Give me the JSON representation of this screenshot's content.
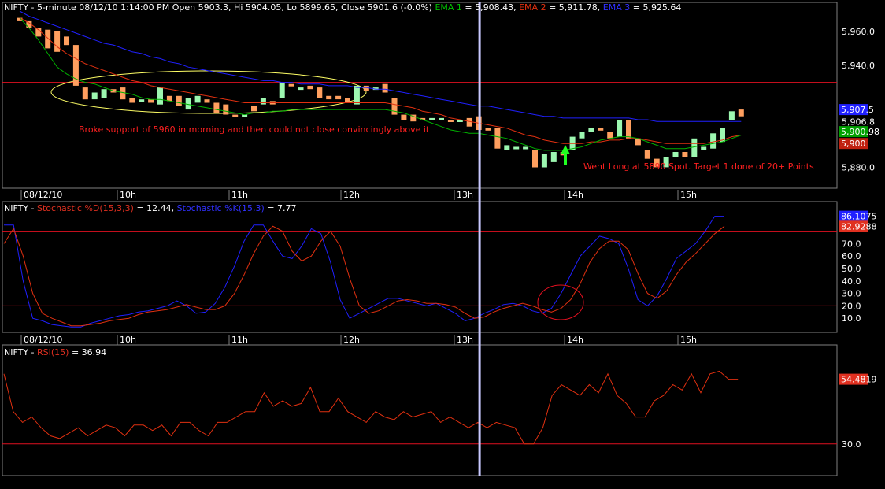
{
  "colors": {
    "background": "#000000",
    "grid": "#7f7f7f",
    "text": "#ffffff",
    "ema1": "#00b000",
    "ema2": "#e03010",
    "ema3": "#2020ff",
    "bull": "#9cf7b0",
    "bear": "#ff9f5f",
    "hline": "#e01020",
    "cursor": "#c8c8ff",
    "ellipse": "#ffff66",
    "circle": "#e01020",
    "arrow": "#20ff20",
    "annotation": "#ff2020"
  },
  "header": {
    "symbol": "NIFTY",
    "info": " - 5-minute 08/12/10 1:14:00 PM Open 5903.3, Hi 5904.05, Lo 5899.65, Close 5901.6 (-0.0%) ",
    "ema1_label": "EMA 1",
    "ema1_value": " = 5,908.43, ",
    "ema2_label": "EMA 2",
    "ema2_value": " = 5,911.78, ",
    "ema3_label": "EMA 3",
    "ema3_value": " = 5,925.64"
  },
  "stoch_header": {
    "symbol": "NIFTY",
    "sep": " - ",
    "d_label": "Stochastic %D(15,3,3)",
    "d_value": " = 12.44, ",
    "k_label": "Stochastic %K(15,3)",
    "k_value": " = 7.77"
  },
  "rsi_header": {
    "symbol": "NIFTY",
    "sep": " - ",
    "label": "RSI(15)",
    "value": " = 36.94"
  },
  "time_axis": [
    "08/12/10",
    "10h",
    "11h",
    "12h",
    "13h",
    "14h",
    "15h"
  ],
  "annotations": {
    "breakdown": "Broke support of 5960 in morning and then could not close convincingly above it",
    "long": "Went Long at 5890 Spot. Target 1 done of 20+ Points"
  },
  "chart_data": [
    {
      "type": "candlestick",
      "series_names": [
        "EMA 1",
        "EMA 2",
        "EMA 3"
      ],
      "ylim": [
        5870,
        5972
      ],
      "yticks": [
        5880,
        5906.8,
        5940,
        5960
      ],
      "ytick_labels": [
        "5,880.0",
        "5,906.8",
        "5,940.0",
        "5,960.0"
      ],
      "value_tags": [
        {
          "label": "5,907.5",
          "value": 5914,
          "color": "#2020ff"
        },
        {
          "label": "5,900.98",
          "value": 5901,
          "color": "#00a000"
        },
        {
          "label": "5,900",
          "value": 5894,
          "color": "#c02010"
        }
      ],
      "hline": 5930,
      "cursor_index": 49,
      "candles": [
        {
          "o": 5968,
          "c": 5966
        },
        {
          "o": 5966,
          "c": 5962
        },
        {
          "o": 5962,
          "c": 5957
        },
        {
          "o": 5961,
          "c": 5950
        },
        {
          "o": 5960,
          "c": 5948
        },
        {
          "o": 5957,
          "c": 5952
        },
        {
          "o": 5952,
          "c": 5928
        },
        {
          "o": 5927,
          "c": 5920
        },
        {
          "o": 5920,
          "c": 5924
        },
        {
          "o": 5921,
          "c": 5926
        },
        {
          "o": 5926,
          "c": 5924
        },
        {
          "o": 5927,
          "c": 5920
        },
        {
          "o": 5921,
          "c": 5918
        },
        {
          "o": 5919,
          "c": 5920
        },
        {
          "o": 5920,
          "c": 5918
        },
        {
          "o": 5917,
          "c": 5927
        },
        {
          "o": 5922,
          "c": 5919
        },
        {
          "o": 5922,
          "c": 5916
        },
        {
          "o": 5914,
          "c": 5921
        },
        {
          "o": 5918,
          "c": 5922
        },
        {
          "o": 5920,
          "c": 5918
        },
        {
          "o": 5918,
          "c": 5912
        },
        {
          "o": 5917,
          "c": 5911
        },
        {
          "o": 5911,
          "c": 5910
        },
        {
          "o": 5910,
          "c": 5911
        },
        {
          "o": 5916,
          "c": 5913
        },
        {
          "o": 5917,
          "c": 5921
        },
        {
          "o": 5919,
          "c": 5917
        },
        {
          "o": 5921,
          "c": 5930
        },
        {
          "o": 5929,
          "c": 5928
        },
        {
          "o": 5927,
          "c": 5927
        },
        {
          "o": 5928,
          "c": 5926
        },
        {
          "o": 5927,
          "c": 5921
        },
        {
          "o": 5922,
          "c": 5920
        },
        {
          "o": 5922,
          "c": 5920
        },
        {
          "o": 5921,
          "c": 5918
        },
        {
          "o": 5917,
          "c": 5928
        },
        {
          "o": 5928,
          "c": 5925
        },
        {
          "o": 5927,
          "c": 5927
        },
        {
          "o": 5929,
          "c": 5924
        },
        {
          "o": 5921,
          "c": 5911
        },
        {
          "o": 5911,
          "c": 5908
        },
        {
          "o": 5911,
          "c": 5907
        },
        {
          "o": 5909,
          "c": 5908
        },
        {
          "o": 5908,
          "c": 5909
        },
        {
          "o": 5909,
          "c": 5909
        },
        {
          "o": 5908,
          "c": 5907
        },
        {
          "o": 5908,
          "c": 5908
        },
        {
          "o": 5909,
          "c": 5904
        },
        {
          "o": 5910,
          "c": 5902
        },
        {
          "o": 5903,
          "c": 5902
        },
        {
          "o": 5903,
          "c": 5891
        },
        {
          "o": 5890,
          "c": 5893
        },
        {
          "o": 5892,
          "c": 5892
        },
        {
          "o": 5892,
          "c": 5892
        },
        {
          "o": 5890,
          "c": 5880
        },
        {
          "o": 5880,
          "c": 5888
        },
        {
          "o": 5883,
          "c": 5889
        },
        {
          "o": 5889,
          "c": 5887
        },
        {
          "o": 5890,
          "c": 5898
        },
        {
          "o": 5897,
          "c": 5901
        },
        {
          "o": 5901,
          "c": 5903
        },
        {
          "o": 5903,
          "c": 5902
        },
        {
          "o": 5901,
          "c": 5897
        },
        {
          "o": 5898,
          "c": 5908
        },
        {
          "o": 5908,
          "c": 5897
        },
        {
          "o": 5897,
          "c": 5893
        },
        {
          "o": 5890,
          "c": 5885
        },
        {
          "o": 5885,
          "c": 5880
        },
        {
          "o": 5880,
          "c": 5886
        },
        {
          "o": 5886,
          "c": 5889
        },
        {
          "o": 5889,
          "c": 5886
        },
        {
          "o": 5886,
          "c": 5897
        },
        {
          "o": 5890,
          "c": 5892
        },
        {
          "o": 5891,
          "c": 5900
        },
        {
          "o": 5895,
          "c": 5903
        },
        {
          "o": 5908,
          "c": 5913
        },
        {
          "o": 5914,
          "c": 5910
        }
      ],
      "ema1": [
        5968,
        5962,
        5955,
        5947,
        5939,
        5935,
        5932,
        5930,
        5929,
        5927,
        5925,
        5924,
        5923,
        5921,
        5920,
        5920,
        5919,
        5918,
        5917,
        5916,
        5915,
        5914,
        5913,
        5912,
        5911,
        5912,
        5912,
        5913,
        5913,
        5914,
        5914,
        5914,
        5914,
        5914,
        5914,
        5914,
        5914,
        5914,
        5914,
        5914,
        5913,
        5912,
        5910,
        5908,
        5906,
        5904,
        5902,
        5901,
        5900,
        5900,
        5899,
        5898,
        5897,
        5895,
        5893,
        5891,
        5890,
        5890,
        5890,
        5891,
        5892,
        5894,
        5896,
        5897,
        5898,
        5898,
        5897,
        5895,
        5893,
        5891,
        5891,
        5891,
        5892,
        5893,
        5894,
        5895,
        5897,
        5899
      ],
      "ema2": [
        5968,
        5965,
        5961,
        5956,
        5951,
        5947,
        5944,
        5941,
        5939,
        5937,
        5935,
        5933,
        5931,
        5930,
        5928,
        5927,
        5926,
        5925,
        5924,
        5923,
        5922,
        5921,
        5920,
        5919,
        5918,
        5918,
        5918,
        5918,
        5918,
        5918,
        5918,
        5918,
        5918,
        5918,
        5918,
        5918,
        5918,
        5918,
        5918,
        5918,
        5917,
        5916,
        5915,
        5913,
        5912,
        5911,
        5909,
        5908,
        5907,
        5906,
        5905,
        5904,
        5903,
        5901,
        5899,
        5898,
        5896,
        5895,
        5894,
        5894,
        5894,
        5895,
        5895,
        5896,
        5896,
        5897,
        5897,
        5896,
        5895,
        5894,
        5894,
        5894,
        5894,
        5894,
        5895,
        5896,
        5898,
        5899
      ],
      "ema3": [
        5972,
        5969,
        5967,
        5965,
        5963,
        5961,
        5959,
        5957,
        5955,
        5953,
        5952,
        5950,
        5948,
        5947,
        5945,
        5944,
        5942,
        5941,
        5939,
        5938,
        5937,
        5936,
        5935,
        5934,
        5933,
        5932,
        5931,
        5931,
        5930,
        5930,
        5929,
        5929,
        5929,
        5928,
        5928,
        5928,
        5927,
        5927,
        5926,
        5926,
        5925,
        5924,
        5923,
        5922,
        5921,
        5920,
        5919,
        5918,
        5917,
        5916,
        5916,
        5915,
        5914,
        5913,
        5912,
        5911,
        5910,
        5910,
        5909,
        5909,
        5909,
        5909,
        5909,
        5909,
        5909,
        5909,
        5908,
        5908,
        5907,
        5907,
        5907,
        5907,
        5907,
        5907,
        5907,
        5907,
        5907,
        5907
      ]
    },
    {
      "type": "line",
      "series_names": [
        "Stochastic %D(15,3,3)",
        "Stochastic %K(15,3)"
      ],
      "ylim": [
        0,
        100
      ],
      "yticks": [
        10,
        20,
        30,
        40,
        50,
        60,
        70
      ],
      "ytick_labels": [
        "10.0",
        "20.0",
        "30.0",
        "40.0",
        "50.0",
        "60.0",
        "70.0"
      ],
      "value_tags": [
        {
          "label": "86.1075",
          "value": 92,
          "color": "#2020ff"
        },
        {
          "label": "82.9288",
          "value": 84,
          "color": "#e03020"
        }
      ],
      "hlines": [
        20,
        80
      ],
      "d": [
        70,
        82,
        60,
        30,
        14,
        10,
        7,
        4,
        4,
        5,
        6,
        8,
        9,
        10,
        13,
        15,
        16,
        17,
        19,
        21,
        19,
        17,
        17,
        20,
        30,
        45,
        62,
        76,
        84,
        80,
        64,
        56,
        60,
        72,
        80,
        68,
        42,
        20,
        14,
        16,
        20,
        24,
        25,
        24,
        22,
        22,
        21,
        19,
        14,
        10,
        11,
        15,
        18,
        20,
        22,
        20,
        17,
        15,
        18,
        25,
        38,
        55,
        66,
        72,
        72,
        65,
        46,
        30,
        26,
        32,
        45,
        55,
        62,
        70,
        78,
        84
      ],
      "k": [
        85,
        85,
        40,
        10,
        8,
        5,
        4,
        3,
        3,
        6,
        8,
        10,
        12,
        13,
        15,
        16,
        18,
        20,
        24,
        20,
        14,
        15,
        22,
        35,
        52,
        72,
        85,
        85,
        72,
        60,
        58,
        68,
        82,
        78,
        55,
        25,
        10,
        14,
        18,
        22,
        26,
        26,
        24,
        22,
        20,
        22,
        18,
        14,
        8,
        10,
        14,
        17,
        21,
        22,
        20,
        16,
        14,
        18,
        30,
        45,
        60,
        68,
        76,
        74,
        70,
        50,
        25,
        20,
        28,
        42,
        58,
        64,
        70,
        80,
        92,
        92
      ]
    },
    {
      "type": "line",
      "series_names": [
        "RSI(15)"
      ],
      "ylim": [
        20,
        65
      ],
      "yticks": [
        30
      ],
      "ytick_labels": [
        "30.0"
      ],
      "value_tags": [
        {
          "label": "54.4819",
          "value": 54,
          "color": "#e03020"
        }
      ],
      "hlines": [
        30
      ],
      "rsi": [
        56,
        42,
        38,
        40,
        36,
        33,
        32,
        34,
        36,
        33,
        35,
        37,
        36,
        33,
        37,
        37,
        35,
        37,
        33,
        38,
        38,
        35,
        33,
        38,
        38,
        40,
        42,
        42,
        49,
        44,
        46,
        44,
        45,
        51,
        42,
        42,
        47,
        42,
        40,
        38,
        42,
        40,
        39,
        42,
        40,
        41,
        42,
        38,
        40,
        38,
        36,
        38,
        36,
        38,
        37,
        36,
        30,
        30,
        36,
        48,
        52,
        50,
        48,
        52,
        49,
        56,
        48,
        45,
        40,
        40,
        46,
        48,
        52,
        50,
        56,
        49,
        56,
        57,
        54,
        54
      ]
    }
  ]
}
